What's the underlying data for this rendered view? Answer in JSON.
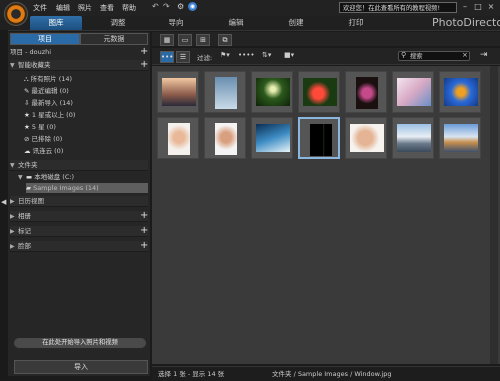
{
  "menu": [
    "文件",
    "编辑",
    "照片",
    "查看",
    "帮助"
  ],
  "tabs": [
    "图库",
    "调整",
    "导向",
    "编辑",
    "创建",
    "打印"
  ],
  "welcome_text": "欢迎您！在此查看所有的教程视频!",
  "brand": "PhotoDirector",
  "left_panel": {
    "tab_project": "项目",
    "tab_metadata": "元数据",
    "project_name": "项目 - douzhi",
    "smart_collections": "智能收藏夹",
    "collections": [
      {
        "label": "所有照片 (14)"
      },
      {
        "label": "最近编辑 (0)"
      },
      {
        "label": "最新导入 (14)"
      },
      {
        "label": "1 星或以上 (0)"
      },
      {
        "label": "5 星 (0)"
      },
      {
        "label": "已排除 (0)"
      },
      {
        "label": "讯连云 (0)"
      }
    ],
    "folders": "文件夹",
    "local_disk": "本地磁盘 (C:)",
    "sample_folder": "Sample Images (14)",
    "calendar": "日历视图",
    "albums": "相册",
    "tags": "标记",
    "faces": "脸部",
    "import_hint": "在此处开始导入照片和视频",
    "import_button": "导入"
  },
  "toolbar": {
    "filter_label": "过滤:",
    "search_placeholder": "搜索"
  },
  "status": {
    "selection": "选择 1 张 - 显示 14 张",
    "path": "文件夹 / Sample Images / Window.jpg"
  },
  "colors": {
    "accent": "#2f6fa8",
    "selected_border": "#8ab6df"
  },
  "thumbnails": [
    {
      "name": "thumb-sunset-sky",
      "bg": "linear-gradient(#f2c8a2,#8a5a4a 60%,#2a2a3a)",
      "shape": "land"
    },
    {
      "name": "thumb-ice-sculpture",
      "bg": "linear-gradient(#6a8fb0,#c9dbe8)",
      "shape": "port"
    },
    {
      "name": "thumb-forest",
      "bg": "radial-gradient(circle at 50% 40%,#e8f0b0 0 10%,#2c5a1c 40%,#0e2208)",
      "shape": "land"
    },
    {
      "name": "thumb-red-flower",
      "bg": "radial-gradient(circle at 45% 55%,#ff4a3a 0 22%,#1a3a12 50%)",
      "shape": "land"
    },
    {
      "name": "thumb-dark-flower",
      "bg": "radial-gradient(circle at 50% 50%,#c44a8a 0 25%,#1a1010 55%)",
      "shape": "port"
    },
    {
      "name": "thumb-blossoms",
      "bg": "linear-gradient(135deg,#f4e6f0,#d7a9c4 50%,#6a90c8)",
      "shape": "land"
    },
    {
      "name": "thumb-bird",
      "bg": "radial-gradient(circle at 50% 50%,#f0a020 0 18%,#2a6ad8 45%,#133a88)",
      "shape": "land"
    },
    {
      "name": "thumb-woman-hat",
      "bg": "radial-gradient(circle at 50% 45%,#e8b898 0 25%,#f4f0ec 60%)",
      "shape": "port"
    },
    {
      "name": "thumb-woman-portrait",
      "bg": "radial-gradient(circle at 50% 45%,#d9a080 0 25%,#f4f4f4 60%)",
      "shape": "port"
    },
    {
      "name": "thumb-wave",
      "bg": "linear-gradient(160deg,#0b2e52,#3d8cc4 50%,#e8f4f8)",
      "shape": "land"
    },
    {
      "name": "thumb-window",
      "bg": "linear-gradient(90deg,#000 0 60%,#224422 62%,#000 66%)",
      "shape": "port"
    },
    {
      "name": "thumb-woman-cheek",
      "bg": "radial-gradient(circle at 45% 50%,#e4b494 0 30%,#f6f2ee 60%)",
      "shape": "land"
    },
    {
      "name": "thumb-panorama-road",
      "bg": "linear-gradient(#9cc0e4,#e8eef4 45%,#6a7a8a 70%,#3a4a5a)",
      "shape": "land"
    },
    {
      "name": "thumb-panorama-city",
      "bg": "linear-gradient(#6a9cd8,#d8e4f0 45%,#c89050 65%,#40506a)",
      "shape": "land"
    }
  ]
}
